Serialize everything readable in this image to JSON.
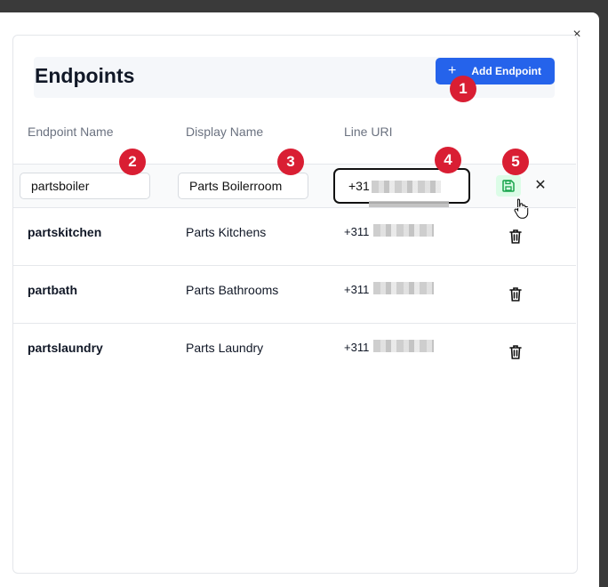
{
  "dialog": {
    "close_label": "×"
  },
  "header": {
    "title": "Endpoints",
    "add_button": "Add Endpoint"
  },
  "columns": [
    "Endpoint Name",
    "Display Name",
    "Line URI"
  ],
  "edit_row": {
    "endpoint_name": "partsboiler",
    "display_name": "Parts Boilerroom",
    "line_uri_prefix": "+31"
  },
  "rows": [
    {
      "endpoint_name": "partskitchen",
      "display_name": "Parts Kitchens",
      "line_uri_prefix": "+311"
    },
    {
      "endpoint_name": "partbath",
      "display_name": "Parts Bathrooms",
      "line_uri_prefix": "+311"
    },
    {
      "endpoint_name": "partslaundry",
      "display_name": "Parts Laundry",
      "line_uri_prefix": "+311"
    }
  ],
  "badges": [
    "1",
    "2",
    "3",
    "4",
    "5"
  ],
  "colors": {
    "accent": "#2563eb",
    "badge": "#d91e33",
    "save_bg": "#dcfce7",
    "save_icon": "#16a34a"
  }
}
